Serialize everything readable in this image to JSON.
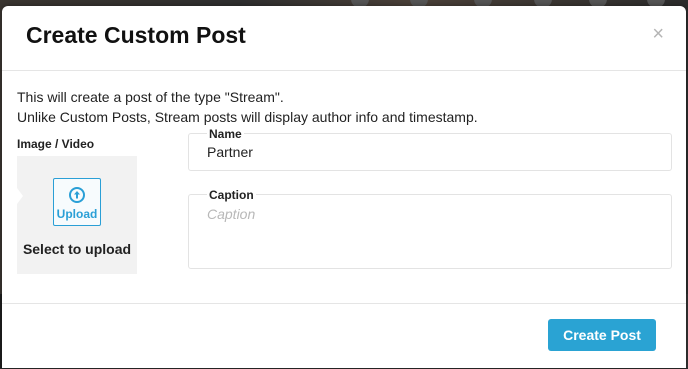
{
  "modal": {
    "title": "Create Custom Post",
    "close_glyph": "×",
    "intro_line1": "This will create a post of the type \"Stream\".",
    "intro_line2": "Unlike Custom Posts, Stream posts will display author info and timestamp."
  },
  "media": {
    "label": "Image / Video",
    "upload_label": "Upload",
    "upload_icon": "arrow-up-circle-icon",
    "select_text": "Select to upload"
  },
  "fields": {
    "name_label": "Name",
    "name_value": "Partner",
    "caption_label": "Caption",
    "caption_value": "",
    "caption_placeholder": "Caption"
  },
  "footer": {
    "create_label": "Create Post"
  },
  "colors": {
    "accent": "#2aa3d3",
    "upload_border": "#2a9fd6"
  }
}
